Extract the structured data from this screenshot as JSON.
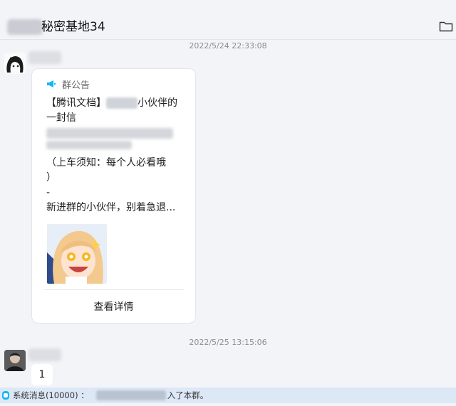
{
  "header": {
    "title": "秘密基地34"
  },
  "messages": [
    {
      "timestamp": "2022/5/24 22:33:08"
    },
    {
      "timestamp": "2022/5/25 13:15:06",
      "text": "1"
    }
  ],
  "announcement": {
    "header_label": "群公告",
    "line1_prefix": "【腾讯文档】",
    "line1_suffix": "小伙伴的",
    "line2": "一封信",
    "line4": "（上车须知：每个人必看哦",
    "line5": "）",
    "line6": "-",
    "line7": "新进群的小伙伴，别着急退...",
    "footer_label": "查看详情"
  },
  "system_bar": {
    "label": "系统消息(10000) ：",
    "tail": "入了本群。"
  },
  "icons": {
    "folder": "folder-icon",
    "megaphone": "megaphone-icon",
    "system": "info-icon"
  },
  "colors": {
    "accent": "#12b7f5",
    "system_bar": "#dde8f7"
  }
}
